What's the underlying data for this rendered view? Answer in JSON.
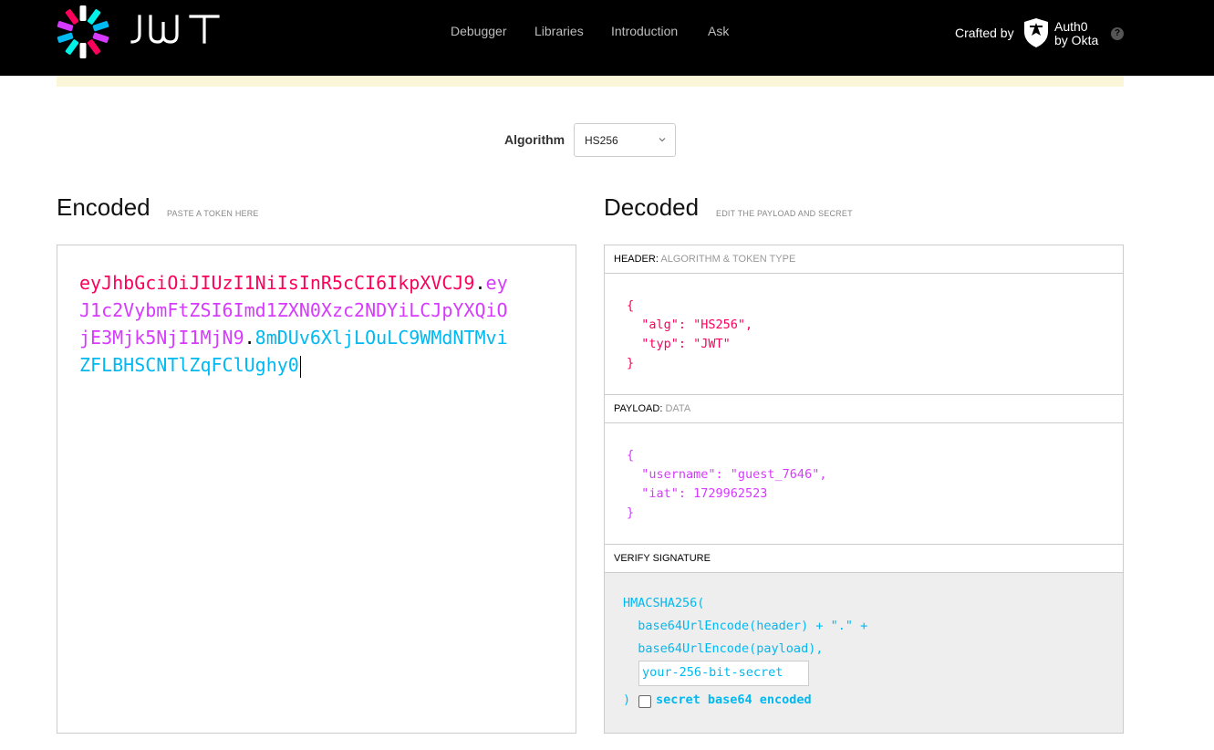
{
  "nav": {
    "logo_text": "JWT",
    "items": [
      "Debugger",
      "Libraries",
      "Introduction",
      "Ask"
    ],
    "crafted_by": "Crafted by",
    "auth0_line1": "Auth0",
    "auth0_line2": "by Okta",
    "help": "?"
  },
  "algorithm": {
    "label": "Algorithm",
    "selected": "HS256"
  },
  "encoded": {
    "title": "Encoded",
    "subtitle": "PASTE A TOKEN HERE",
    "token_header": "eyJhbGciOiJIUzI1NiIsInR5cCI6IkpXVCJ9",
    "token_payload": "eyJ1c2VybmFtZSI6Imd1ZXN0Xzc2NDYiLCJpYXQiOjE3Mjk5NjI1MjN9",
    "token_signature": "8mDUv6XljLOuLC9WMdNTMviZFLBHSCNTlZqFClUghy0",
    "dot": "."
  },
  "decoded": {
    "title": "Decoded",
    "subtitle": "EDIT THE PAYLOAD AND SECRET",
    "header_label": "HEADER:",
    "header_sub": "ALGORITHM & TOKEN TYPE",
    "header_json": "{\n  \"alg\": \"HS256\",\n  \"typ\": \"JWT\"\n}",
    "payload_label": "PAYLOAD:",
    "payload_sub": "DATA",
    "payload_json": "{\n  \"username\": \"guest_7646\",\n  \"iat\": 1729962523\n}",
    "verify_label": "VERIFY SIGNATURE",
    "sig_line1": "HMACSHA256(",
    "sig_line2": "  base64UrlEncode(header) + \".\" +",
    "sig_line3": "  base64UrlEncode(payload),",
    "secret_placeholder": "your-256-bit-secret",
    "close_paren": ")",
    "base64_label": "secret base64 encoded"
  },
  "colors": {
    "header": "#fb015b",
    "payload": "#d63aff",
    "signature": "#00b9f1"
  }
}
